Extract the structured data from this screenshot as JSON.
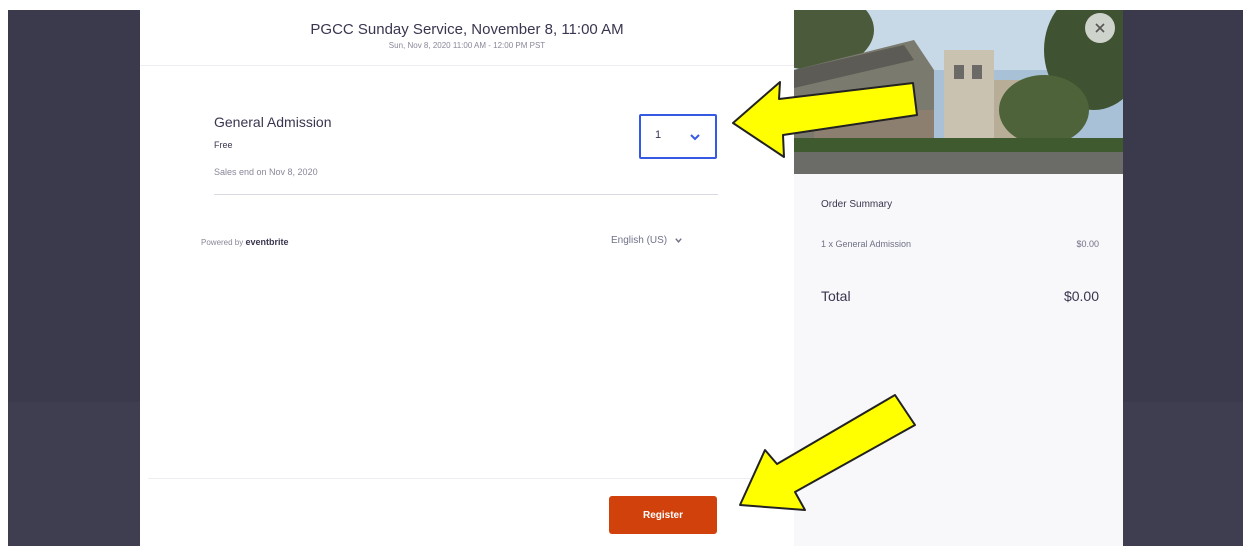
{
  "event": {
    "title": "PGCC Sunday Service, November 8, 11:00 AM",
    "date": "Sun, Nov 8, 2020 11:00 AM - 12:00 PM PST"
  },
  "ticket": {
    "name": "General Admission",
    "price": "Free",
    "sales_end": "Sales end on Nov 8, 2020",
    "quantity": "1"
  },
  "footer": {
    "powered_by": "Powered by",
    "brand": "eventbrite",
    "language": "English (US)",
    "register_label": "Register"
  },
  "order_summary": {
    "title": "Order Summary",
    "item_label": "1 x General Admission",
    "item_price": "$0.00",
    "total_label": "Total",
    "total_value": "$0.00"
  },
  "colors": {
    "accent": "#3659e3",
    "register": "#d1410c",
    "overlay": "#3b3a4d",
    "arrow": "#ffff00"
  },
  "icons": [
    "chevron-down-icon",
    "close-icon",
    "arrow-annotation"
  ]
}
